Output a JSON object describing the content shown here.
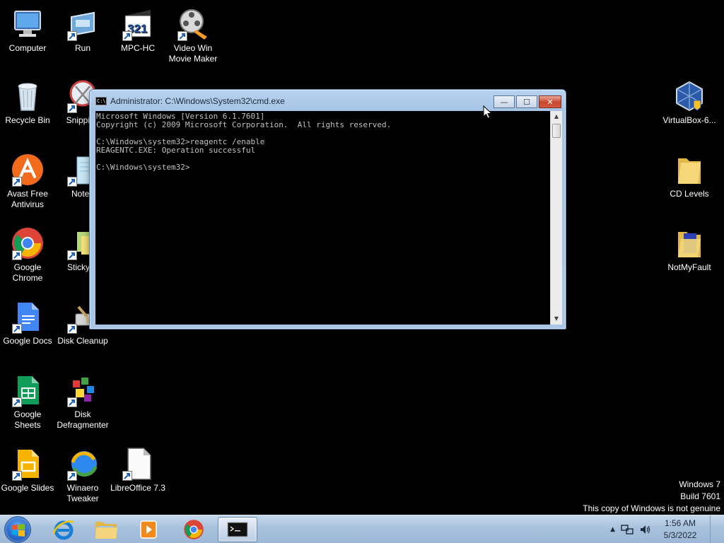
{
  "desktop": {
    "icons": [
      {
        "label": "Computer"
      },
      {
        "label": "Run"
      },
      {
        "label": "MPC-HC"
      },
      {
        "label": "Video Win Movie Maker"
      },
      {
        "label": "Recycle Bin"
      },
      {
        "label": "Snipping"
      },
      {
        "label": "Avast Free Antivirus"
      },
      {
        "label": "Notep"
      },
      {
        "label": "Google Chrome"
      },
      {
        "label": "Sticky N"
      },
      {
        "label": "Google Docs"
      },
      {
        "label": "Disk Cleanup"
      },
      {
        "label": "Google Sheets"
      },
      {
        "label": "Disk Defragmenter"
      },
      {
        "label": "Google Slides"
      },
      {
        "label": "Winaero Tweaker"
      },
      {
        "label": "LibreOffice 7.3"
      },
      {
        "label": "VirtualBox-6..."
      },
      {
        "label": "CD Levels"
      },
      {
        "label": "NotMyFault"
      }
    ]
  },
  "window": {
    "title": "Administrator: C:\\Windows\\System32\\cmd.exe",
    "icon_text": "C:\\",
    "minimize": "—",
    "maximize": "☐",
    "close": "✕",
    "console_text": "Microsoft Windows [Version 6.1.7601]\nCopyright (c) 2009 Microsoft Corporation.  All rights reserved.\n\nC:\\Windows\\system32>reagentc /enable\nREAGENTC.EXE: Operation successful\n\nC:\\Windows\\system32>"
  },
  "watermark": {
    "line1": "Windows 7",
    "line2": "Build 7601",
    "line3": "This copy of Windows is not genuine"
  },
  "taskbar": {
    "pinned": [
      "internet-explorer",
      "windows-explorer",
      "media-player",
      "google-chrome",
      "command-prompt"
    ],
    "tray_chevron": "▲",
    "time": "1:56 AM",
    "date": "5/3/2022"
  }
}
